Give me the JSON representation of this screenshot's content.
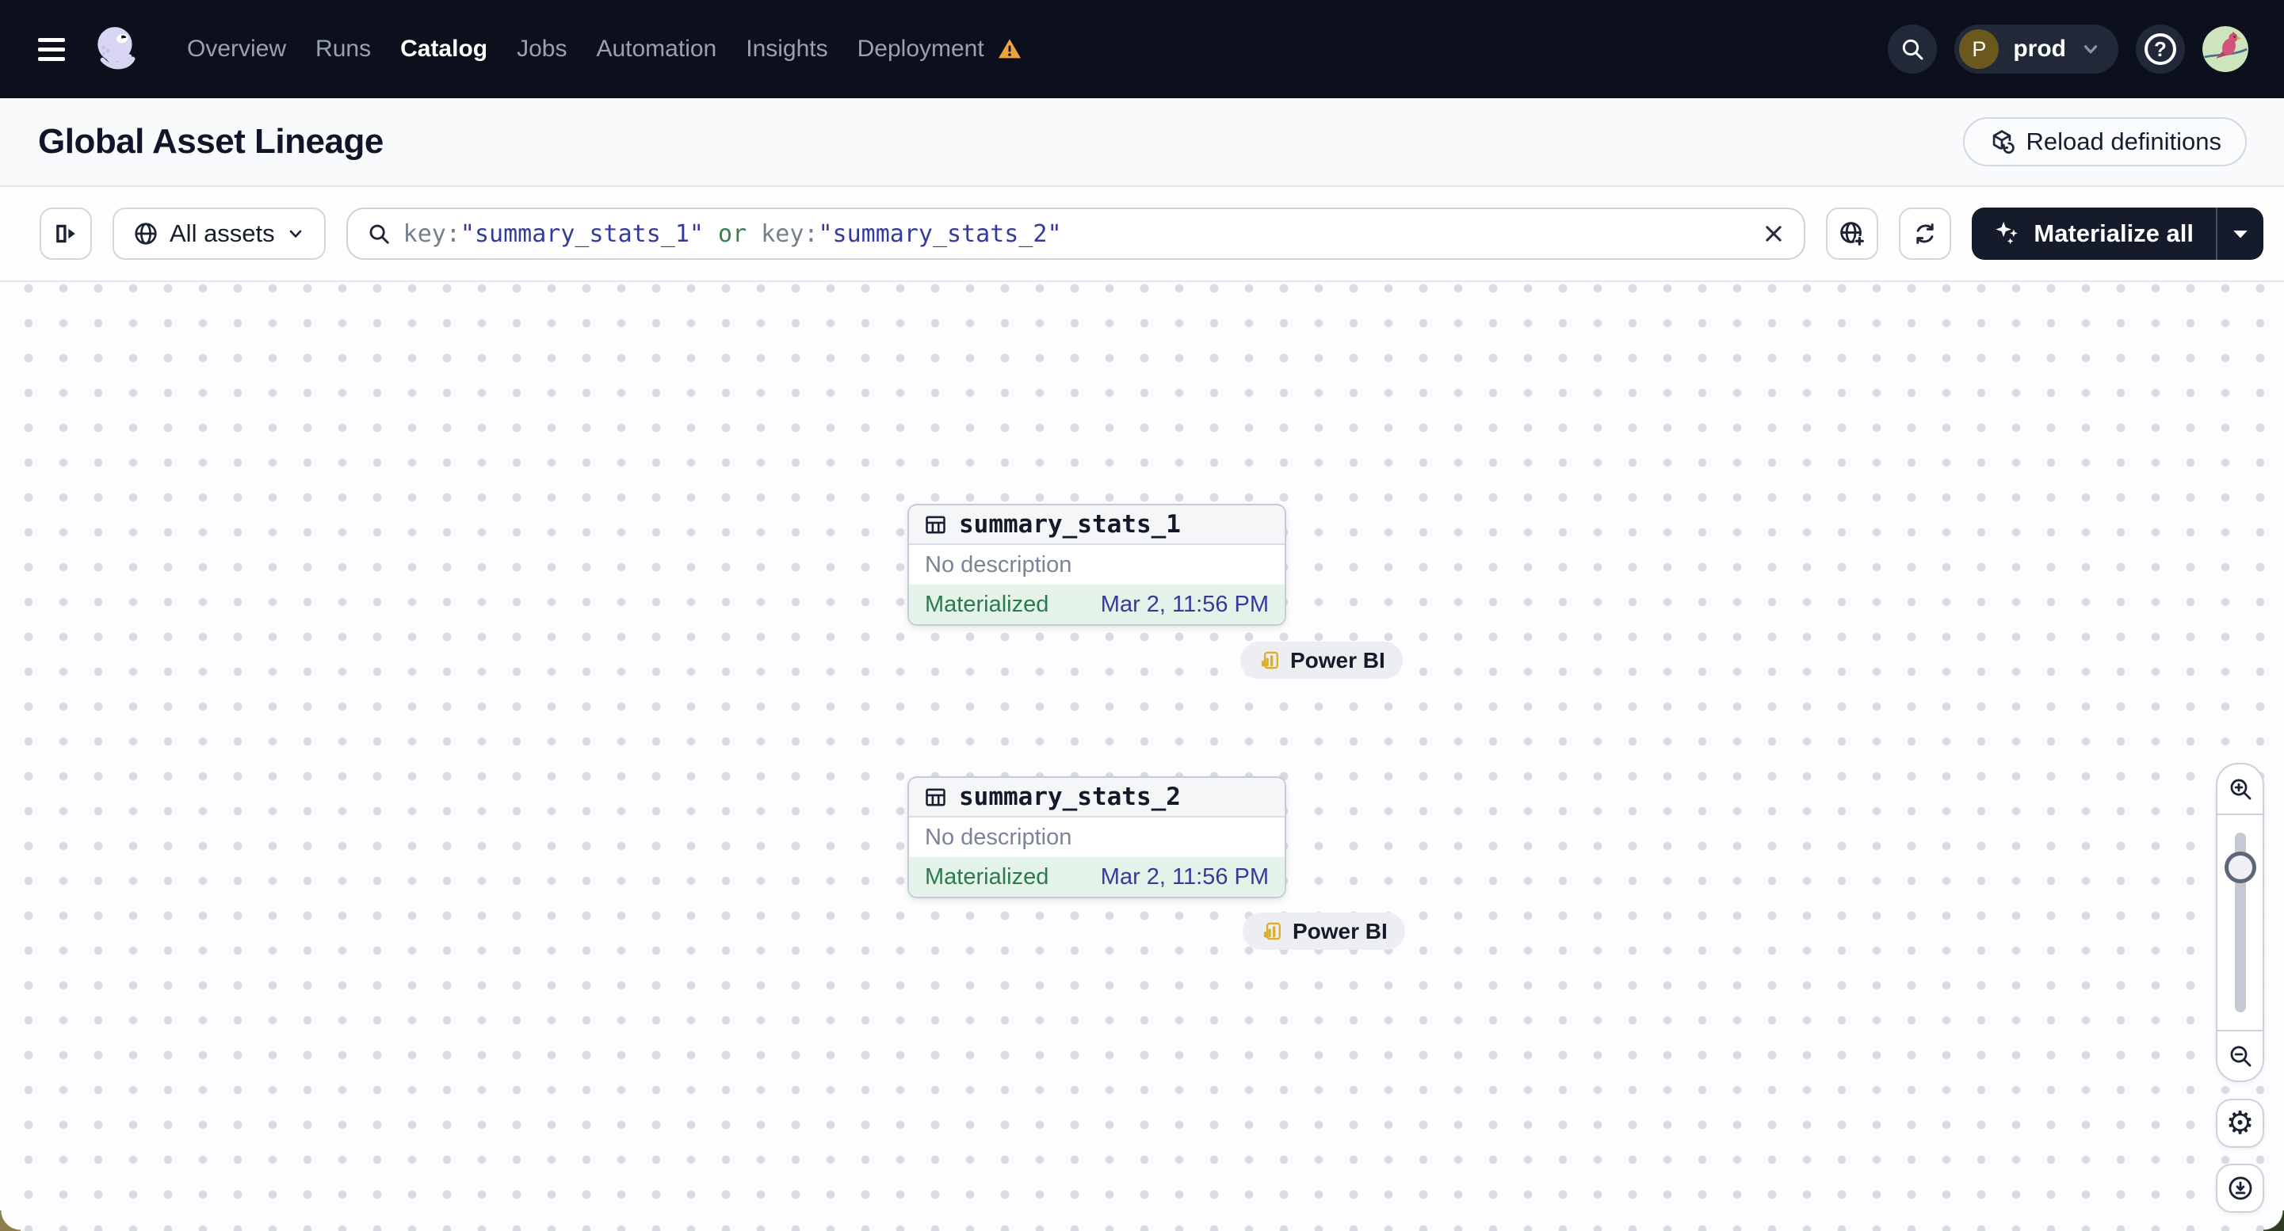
{
  "nav": {
    "items": [
      {
        "label": "Overview",
        "active": false
      },
      {
        "label": "Runs",
        "active": false
      },
      {
        "label": "Catalog",
        "active": true
      },
      {
        "label": "Jobs",
        "active": false
      },
      {
        "label": "Automation",
        "active": false
      },
      {
        "label": "Insights",
        "active": false
      },
      {
        "label": "Deployment",
        "active": false,
        "warning": true
      }
    ],
    "workspace": {
      "initial": "P",
      "name": "prod"
    },
    "help_label": "?"
  },
  "header": {
    "title": "Global Asset Lineage",
    "reload_label": "Reload definitions"
  },
  "toolbar": {
    "filter_label": "All assets",
    "search_segments": [
      "key:",
      "\"summary_stats_1\"",
      " or ",
      "key:",
      "\"summary_stats_2\""
    ],
    "materialize_label": "Materialize all"
  },
  "canvas": {
    "assets": [
      {
        "name": "summary_stats_1",
        "description": "No description",
        "status": "Materialized",
        "timestamp": "Mar 2, 11:56 PM",
        "tag": "Power BI"
      },
      {
        "name": "summary_stats_2",
        "description": "No description",
        "status": "Materialized",
        "timestamp": "Mar 2, 11:56 PM",
        "tag": "Power BI"
      }
    ]
  },
  "colors": {
    "nav_bg": "#0c101d",
    "status_green": "#2a7a4e",
    "status_bg": "#e3f3e9",
    "timestamp_blue": "#353b9d",
    "query_string": "#343b9e",
    "query_operator": "#3e7d52",
    "warning_orange": "#eda43e",
    "powerbi_yellow": "#dcae2e",
    "materialize_bg": "#151b2b"
  }
}
